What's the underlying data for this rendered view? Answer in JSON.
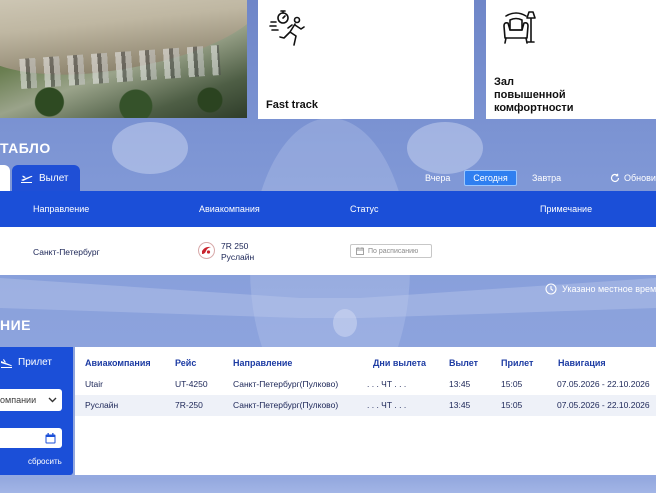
{
  "cards": {
    "fast_track": {
      "title": "Fast track",
      "icon": "running-person-stopwatch-icon"
    },
    "lounge": {
      "title_lines": [
        "Зал",
        "повышенной",
        "комфортности"
      ],
      "icon": "armchair-lamp-icon"
    }
  },
  "board": {
    "title": "ТАБЛО",
    "tab_depart": "Вылет",
    "days": {
      "yesterday": "Вчера",
      "today": "Сегодня",
      "tomorrow": "Завтра"
    },
    "refresh": "Обнови",
    "columns": {
      "direction": "Направление",
      "airline": "Авиакомпания",
      "status": "Статус",
      "note": "Примечание"
    },
    "rows": [
      {
        "direction": "Санкт-Петербург",
        "flight": "7R 250",
        "airline": "Руслайн",
        "status": "По расписанию"
      }
    ],
    "local_time_note": "Указано местное врем"
  },
  "schedule": {
    "title": "НИЕ",
    "tab_arrive": "Прилет",
    "company_select": "омпании",
    "reset": "сбросить",
    "columns": {
      "airline": "Авиакомпания",
      "flight": "Рейс",
      "direction": "Направление",
      "days": "Дни вылета",
      "depart": "Вылет",
      "arrive": "Прилет",
      "navigation": "Навигация"
    },
    "rows": [
      {
        "airline": "Utair",
        "flight": "UT-4250",
        "direction": "Санкт-Петербург(Пулково)",
        "days": ". . . ЧТ . . .",
        "depart": "13:45",
        "arrive": "15:05",
        "navigation": "07.05.2026 - 22.10.2026"
      },
      {
        "airline": "Руслайн",
        "flight": "7R-250",
        "direction": "Санкт-Петербург(Пулково)",
        "days": ". . . ЧТ . . .",
        "depart": "13:45",
        "arrive": "15:05",
        "navigation": "07.05.2026 - 22.10.2026"
      }
    ]
  },
  "colors": {
    "primary_blue": "#1b4fd8",
    "today_blue": "#2f7ff0",
    "heading_blue": "#1c3ba3"
  }
}
